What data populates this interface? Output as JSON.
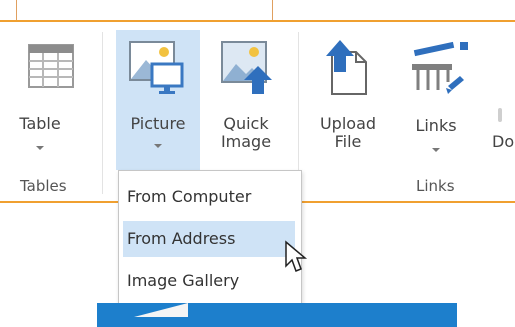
{
  "ribbon": {
    "groups": [
      {
        "label": "Tables"
      },
      {
        "label": "Links"
      }
    ],
    "buttons": {
      "table": {
        "label": "Table"
      },
      "picture": {
        "label": "Picture"
      },
      "quick_image": {
        "label_line1": "Quick",
        "label_line2": "Image"
      },
      "upload_file": {
        "label_line1": "Upload",
        "label_line2": "File"
      },
      "links": {
        "label": "Links"
      },
      "partial": {
        "label": "Do"
      }
    }
  },
  "picture_menu": {
    "items": [
      {
        "label": "From Computer"
      },
      {
        "label": "From Address"
      },
      {
        "label": "Image Gallery"
      }
    ],
    "hovered_item": "From Address"
  },
  "colors": {
    "accent_orange": "#f0a030",
    "selection_blue": "#cfe3f6",
    "brand_blue": "#1d7fcc"
  },
  "icons": {
    "table": "table-grid-icon",
    "picture": "picture-monitor-icon",
    "quick_image": "quick-image-upload-icon",
    "upload_file": "upload-file-icon",
    "links": "links-icon",
    "cursor": "mouse-pointer-icon"
  }
}
